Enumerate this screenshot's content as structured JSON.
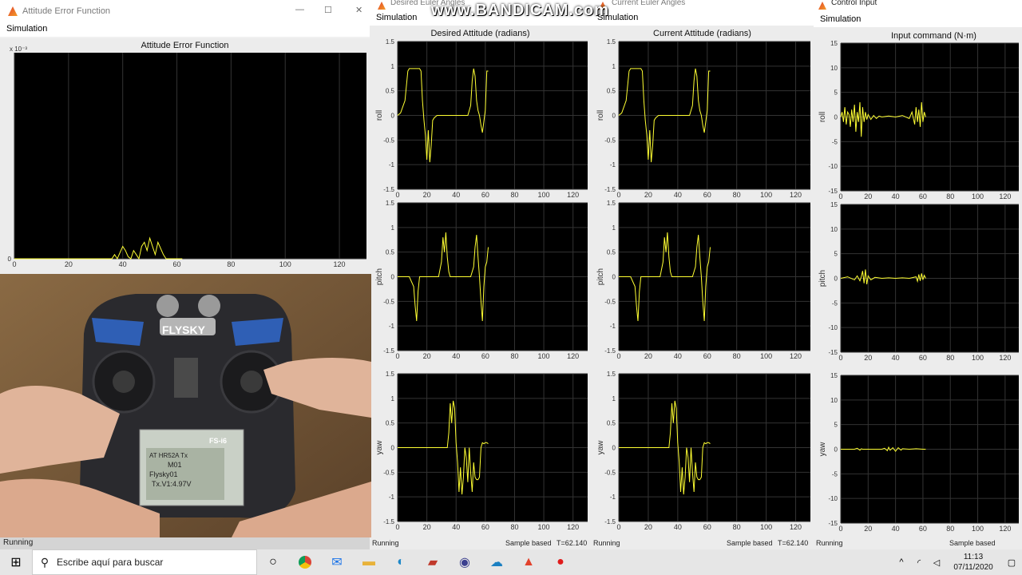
{
  "watermark": "www.BANDICAM.com",
  "error_window": {
    "title": "Attitude Error Function",
    "menu": "Simulation",
    "status": "Running"
  },
  "desired_window": {
    "title": "Desired Euler Angles",
    "menu": "Simulation",
    "status": "Running",
    "sample": "Sample based",
    "time": "T=62.140"
  },
  "current_window": {
    "title": "Current Euler Angles",
    "menu": "Simulation",
    "status": "Running",
    "sample": "Sample based",
    "time": "T=62.140"
  },
  "control_window": {
    "title": "Control Input",
    "menu": "Simulation",
    "status": "Running",
    "sample": "Sample based"
  },
  "taskbar": {
    "search_placeholder": "Escribe aquí para buscar",
    "time": "11:13",
    "date": "07/11/2020"
  },
  "photo": {
    "brand": "FLYSKY",
    "model": "FS-i6",
    "screen_lines": [
      "AT HR52A Tx",
      "M01",
      "Flysky01",
      "Tx.V1:4.97V"
    ]
  },
  "colors": {
    "plot_bg": "#000000",
    "trace": "#ffff33",
    "grid": "#333333",
    "panel": "#ececec"
  },
  "chart_data": [
    {
      "type": "line",
      "title": "Attitude Error Function",
      "y_exponent_label": "x 10⁻³",
      "xlim": [
        0,
        130
      ],
      "ylim": [
        0,
        0.005
      ],
      "xticks": [
        0,
        20,
        40,
        60,
        80,
        100,
        120
      ],
      "yticks": [
        0,
        0.5,
        1,
        1.5,
        2,
        2.5,
        3,
        3.5,
        4,
        4.5,
        5
      ],
      "ytick_labels": [
        "0",
        "0.5",
        "1",
        "1.5",
        "2",
        "2.5",
        "3",
        "3.5",
        "4",
        "4.5",
        "5"
      ],
      "grid": true,
      "series": [
        {
          "x": [
            0,
            36,
            37,
            38,
            40,
            41,
            42,
            43,
            44,
            45,
            46,
            47,
            48,
            49,
            50,
            51,
            52,
            53,
            54,
            55,
            56,
            58,
            62
          ],
          "y": [
            0,
            0,
            0.0001,
            0,
            0.0003,
            0.0002,
            5e-05,
            0,
            0.0002,
            0.0001,
            0,
            0.0003,
            0.0004,
            0.0002,
            0.0005,
            0.0003,
            0.0001,
            0.0004,
            0.00025,
            0.0001,
            0,
            0,
            0
          ]
        }
      ]
    },
    {
      "type": "line",
      "title": "Desired Attitude (radians)",
      "xlim": [
        0,
        130
      ],
      "ylim": [
        -1.5,
        1.5
      ],
      "xticks": [
        0,
        20,
        40,
        60,
        80,
        100,
        120
      ],
      "yticks": [
        -1.5,
        -1,
        -0.5,
        0,
        0.5,
        1,
        1.5
      ],
      "grid": true,
      "panels": [
        {
          "ylabel": "roll",
          "x": [
            0,
            2,
            5,
            7,
            8,
            15,
            16,
            17,
            18,
            19,
            20,
            21,
            22,
            23,
            24,
            25,
            27,
            28,
            30,
            45,
            46,
            48,
            50,
            51,
            52,
            53,
            54,
            55,
            56,
            57,
            58,
            60,
            61,
            62
          ],
          "y": [
            0,
            0.05,
            0.3,
            0.9,
            0.95,
            0.95,
            0.9,
            0.3,
            -0.1,
            -0.4,
            -0.9,
            -0.3,
            -0.95,
            -0.6,
            -0.1,
            -0.05,
            0,
            0,
            0,
            0,
            0,
            0,
            0.2,
            0.7,
            0.95,
            0.8,
            0.3,
            0.1,
            0,
            -0.2,
            -0.35,
            0.1,
            0.9,
            0.9
          ]
        },
        {
          "ylabel": "pitch",
          "x": [
            0,
            8,
            11,
            12,
            13,
            14,
            15,
            17,
            18,
            20,
            25,
            28,
            30,
            31,
            32,
            33,
            34,
            35,
            36,
            37,
            38,
            40,
            50,
            52,
            53,
            54,
            55,
            56,
            57,
            58,
            59,
            60,
            61,
            62
          ],
          "y": [
            0,
            0,
            -0.2,
            -0.6,
            -0.9,
            -0.3,
            0,
            0,
            0,
            0,
            0,
            0,
            0.3,
            0.8,
            0.5,
            0.9,
            0.4,
            0.1,
            0,
            0,
            0,
            0,
            0,
            0.2,
            0.6,
            0.85,
            0.4,
            0,
            -0.5,
            -0.9,
            -0.2,
            0.2,
            0.3,
            0.6
          ]
        },
        {
          "ylabel": "yaw",
          "x": [
            0,
            34,
            35,
            36,
            37,
            38,
            39,
            40,
            41,
            42,
            43,
            44,
            45,
            46,
            47,
            48,
            49,
            50,
            51,
            52,
            53,
            54,
            55,
            56,
            57,
            58,
            59,
            60,
            61,
            62
          ],
          "y": [
            0,
            0,
            0.3,
            0.9,
            0.5,
            0.95,
            0.8,
            0.1,
            -0.3,
            -0.9,
            -0.4,
            -0.95,
            -0.6,
            0,
            -0.2,
            -0.7,
            0,
            -0.5,
            -0.9,
            -0.3,
            -0.6,
            -0.65,
            -0.65,
            -0.6,
            0,
            0.1,
            0.08,
            0.1,
            0.1,
            0.08
          ]
        }
      ]
    },
    {
      "type": "line",
      "title": "Current Attitude (radians)",
      "xlim": [
        0,
        130
      ],
      "ylim": [
        -1.5,
        1.5
      ],
      "xticks": [
        0,
        20,
        40,
        60,
        80,
        100,
        120
      ],
      "yticks": [
        -1.5,
        -1,
        -0.5,
        0,
        0.5,
        1,
        1.5
      ],
      "grid": true,
      "panels": [
        {
          "ylabel": "roll",
          "x": [
            0,
            2,
            5,
            7,
            8,
            15,
            16,
            17,
            18,
            19,
            20,
            21,
            22,
            23,
            24,
            25,
            27,
            28,
            30,
            45,
            46,
            48,
            50,
            51,
            52,
            53,
            54,
            55,
            56,
            57,
            58,
            60,
            61,
            62
          ],
          "y": [
            0,
            0.05,
            0.3,
            0.9,
            0.95,
            0.95,
            0.9,
            0.3,
            -0.1,
            -0.4,
            -0.9,
            -0.3,
            -0.95,
            -0.6,
            -0.1,
            -0.05,
            0,
            0,
            0,
            0,
            0,
            0,
            0.2,
            0.7,
            0.95,
            0.8,
            0.3,
            0.1,
            0,
            -0.2,
            -0.35,
            0.1,
            0.9,
            0.9
          ]
        },
        {
          "ylabel": "pitch",
          "x": [
            0,
            8,
            11,
            12,
            13,
            14,
            15,
            17,
            18,
            20,
            25,
            28,
            30,
            31,
            32,
            33,
            34,
            35,
            36,
            37,
            38,
            40,
            50,
            52,
            53,
            54,
            55,
            56,
            57,
            58,
            59,
            60,
            61,
            62
          ],
          "y": [
            0,
            0,
            -0.2,
            -0.6,
            -0.9,
            -0.3,
            0,
            0,
            0,
            0,
            0,
            0,
            0.3,
            0.8,
            0.5,
            0.9,
            0.4,
            0.1,
            0,
            0,
            0,
            0,
            0,
            0.2,
            0.6,
            0.85,
            0.4,
            0,
            -0.5,
            -0.9,
            -0.2,
            0.2,
            0.3,
            0.6
          ]
        },
        {
          "ylabel": "yaw",
          "x": [
            0,
            34,
            35,
            36,
            37,
            38,
            39,
            40,
            41,
            42,
            43,
            44,
            45,
            46,
            47,
            48,
            49,
            50,
            51,
            52,
            53,
            54,
            55,
            56,
            57,
            58,
            59,
            60,
            61,
            62
          ],
          "y": [
            0,
            0,
            0.3,
            0.9,
            0.5,
            0.95,
            0.8,
            0.1,
            -0.3,
            -0.9,
            -0.4,
            -0.95,
            -0.6,
            0,
            -0.2,
            -0.7,
            0,
            -0.5,
            -0.9,
            -0.3,
            -0.6,
            -0.65,
            -0.65,
            -0.6,
            0,
            0.1,
            0.08,
            0.1,
            0.1,
            0.08
          ]
        }
      ]
    },
    {
      "type": "line",
      "title": "Input command (N·m)",
      "xlim": [
        0,
        130
      ],
      "ylim": [
        -15,
        15
      ],
      "xticks": [
        0,
        20,
        40,
        60,
        80,
        100,
        120
      ],
      "yticks": [
        -15,
        -10,
        -5,
        0,
        5,
        10,
        15
      ],
      "grid": true,
      "panels": [
        {
          "ylabel": "roll",
          "x": [
            0,
            1,
            2,
            3,
            4,
            5,
            6,
            7,
            8,
            9,
            10,
            11,
            12,
            13,
            14,
            15,
            16,
            17,
            18,
            19,
            20,
            22,
            24,
            26,
            28,
            30,
            35,
            40,
            45,
            50,
            52,
            54,
            55,
            56,
            57,
            58,
            59,
            60,
            61,
            62
          ],
          "y": [
            0,
            1,
            -1,
            2,
            -1.5,
            1,
            0.5,
            -2,
            1.5,
            -1,
            2.5,
            -3,
            1,
            -1,
            3,
            -4,
            2,
            -1,
            1,
            -0.5,
            0.5,
            -0.5,
            0.3,
            -0.3,
            0.2,
            0,
            0.2,
            0,
            0.3,
            -0.3,
            1,
            -1.5,
            2,
            -1,
            1.5,
            -2,
            3,
            -1,
            1,
            0
          ]
        },
        {
          "ylabel": "pitch",
          "x": [
            0,
            5,
            10,
            12,
            14,
            15,
            16,
            17,
            18,
            19,
            20,
            22,
            25,
            30,
            35,
            40,
            45,
            50,
            55,
            56,
            57,
            58,
            59,
            60,
            61,
            62
          ],
          "y": [
            0,
            0.3,
            -0.3,
            0.5,
            -0.5,
            0.3,
            1.5,
            -1,
            1.8,
            -1.2,
            0.5,
            -0.3,
            0.2,
            0,
            0.1,
            0,
            0.1,
            0,
            0.3,
            -0.6,
            0.8,
            -0.5,
            1,
            -0.3,
            0.6,
            0
          ]
        },
        {
          "ylabel": "yaw",
          "x": [
            0,
            10,
            12,
            14,
            15,
            16,
            20,
            25,
            30,
            32,
            34,
            35,
            36,
            38,
            40,
            42,
            44,
            45,
            50,
            55,
            60,
            62
          ],
          "y": [
            0,
            0,
            0.2,
            -0.2,
            0.1,
            0,
            0,
            0,
            0,
            0.2,
            -0.3,
            0.4,
            -0.2,
            0.3,
            -0.4,
            0.3,
            -0.2,
            0.1,
            0,
            0.1,
            0,
            0
          ]
        }
      ]
    }
  ]
}
